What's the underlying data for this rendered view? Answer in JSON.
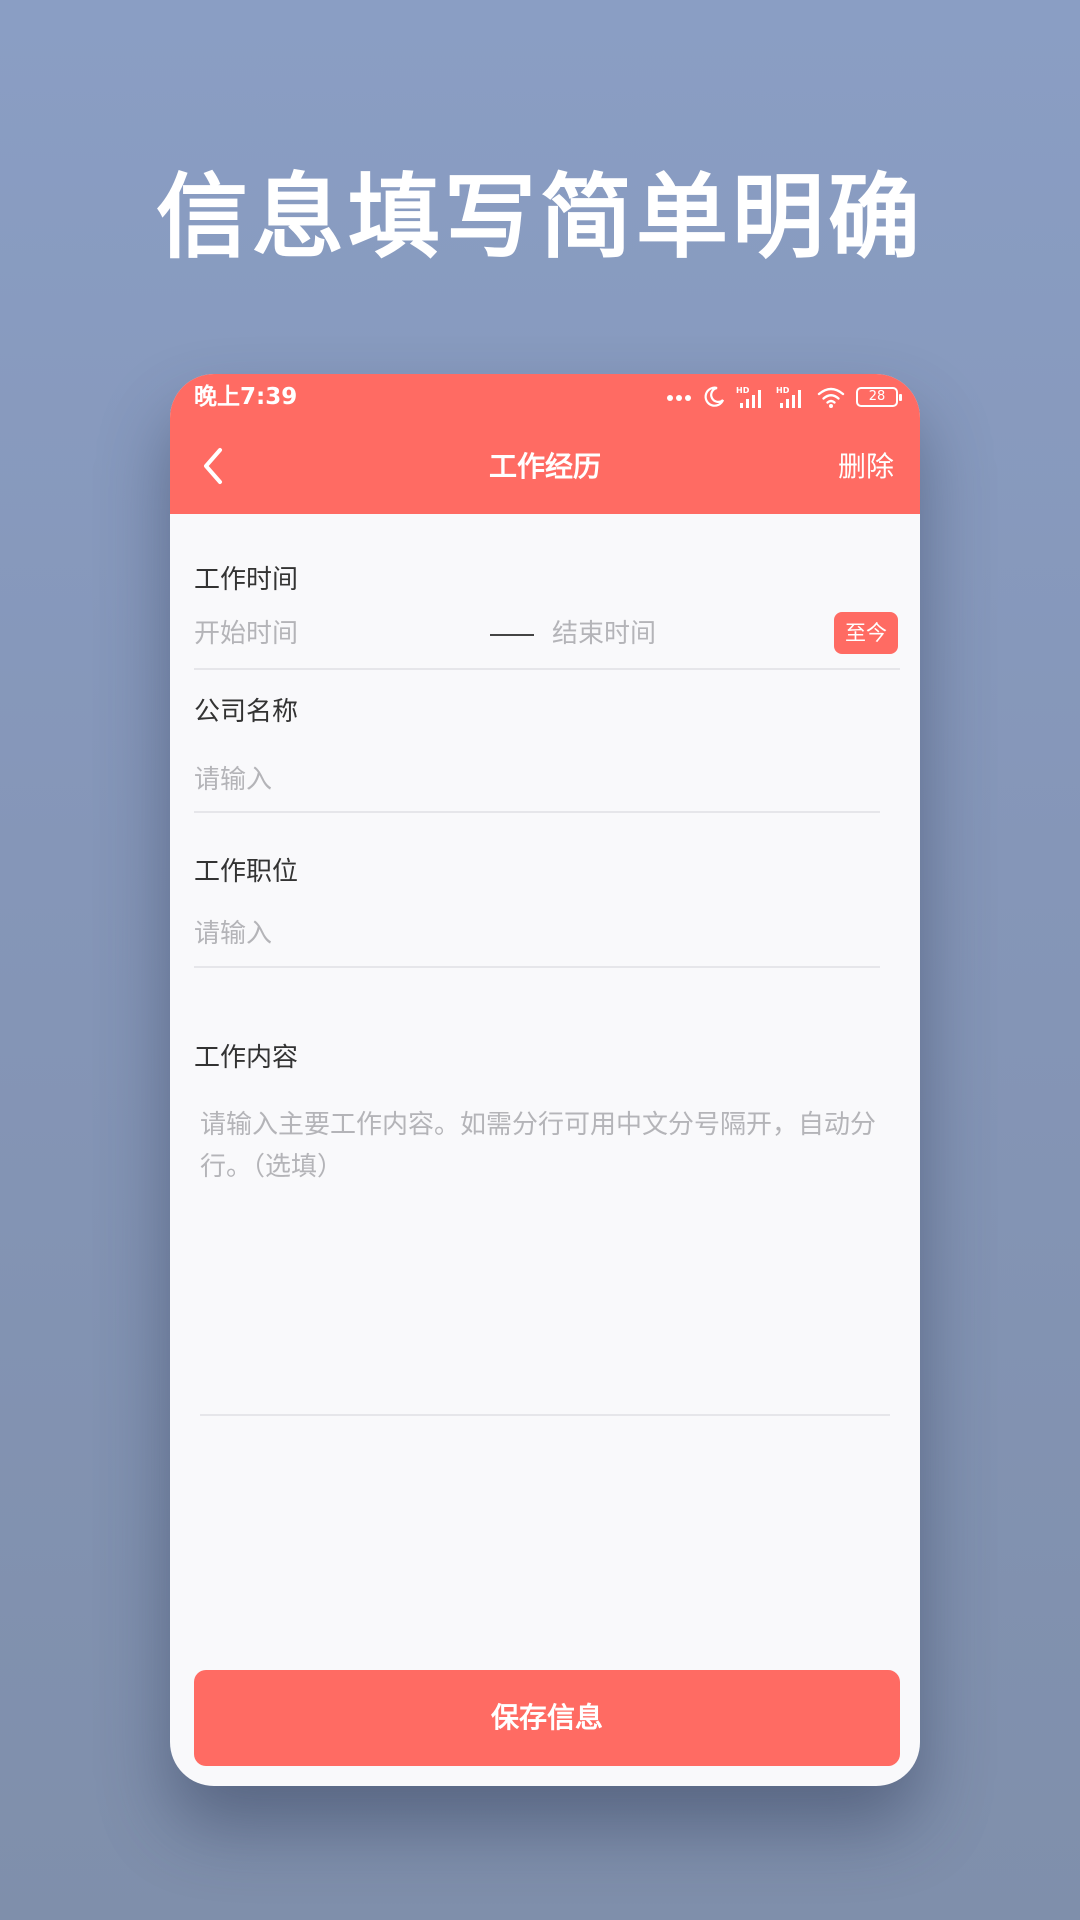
{
  "headline": "信息填写简单明确",
  "colors": {
    "accent": "#ff6b63",
    "background": "#8596b8",
    "card": "#f9f9fb",
    "label_text": "#333333",
    "placeholder_text": "#b4b4b8",
    "divider": "#e6e6ea"
  },
  "status_bar": {
    "time": "晚上7:39",
    "battery": "28",
    "icons": [
      "more-dots-icon",
      "moon-icon",
      "hd-signal-icon",
      "hd-signal-icon",
      "wifi-icon",
      "battery-icon"
    ]
  },
  "nav": {
    "back_icon": "chevron-left-icon",
    "title": "工作经历",
    "delete_label": "删除"
  },
  "form": {
    "work_time": {
      "label": "工作时间",
      "start_placeholder": "开始时间",
      "end_placeholder": "结束时间",
      "until_now_label": "至今"
    },
    "company": {
      "label": "公司名称",
      "placeholder": "请输入",
      "value": ""
    },
    "position": {
      "label": "工作职位",
      "placeholder": "请输入",
      "value": ""
    },
    "content": {
      "label": "工作内容",
      "placeholder": "请输入主要工作内容。如需分行可用中文分号隔开，自动分行。（选填）",
      "value": ""
    }
  },
  "save_button_label": "保存信息"
}
